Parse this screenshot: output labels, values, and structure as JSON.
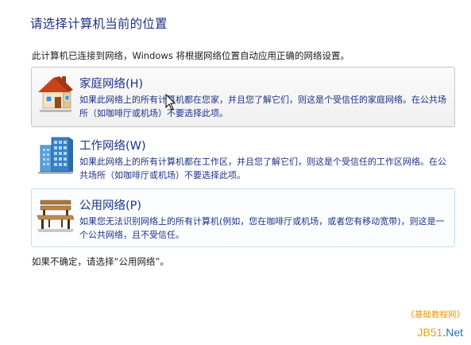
{
  "page": {
    "title": "请选择计算机当前的位置",
    "intro": "此计算机已连接到网络，Windows 将根据网络位置自动应用正确的网络设置。",
    "footer": "如果不确定，请选择“公用网络”。"
  },
  "options": [
    {
      "title": "家庭网络(H)",
      "description": "如果此网络上的所有计算机都在您家，并且您了解它们，则这是个受信任的家庭网络。在公共场所（如咖啡厅或机场）不要选择此项。",
      "icon": "house-icon",
      "state": "hovered"
    },
    {
      "title": "工作网络(W)",
      "description": "如果此网络上的所有计算机都在工作区，并且您了解它们，则这是个受信任的工作区网络。在公共场所（如咖啡厅或机场）不要选择此项。",
      "icon": "office-building-icon",
      "state": "normal"
    },
    {
      "title": "公用网络(P)",
      "description": "如果您无法识别网络上的所有计算机(例如，您在咖啡厅或机场，或者您有移动宽带)，则这是一个公共网络，且不受信任。",
      "icon": "park-bench-icon",
      "state": "selected"
    }
  ],
  "watermark": {
    "text": "《基础教程网》",
    "logo_prefix": "JB51",
    "logo_suffix": ".Net"
  },
  "colors": {
    "link_blue": "#1e3287",
    "hover_border": "#c6c6c6",
    "selected_border": "#bfe0f2",
    "watermark_orange": "#e89a00",
    "watermark_blue": "#2c6fb6"
  }
}
